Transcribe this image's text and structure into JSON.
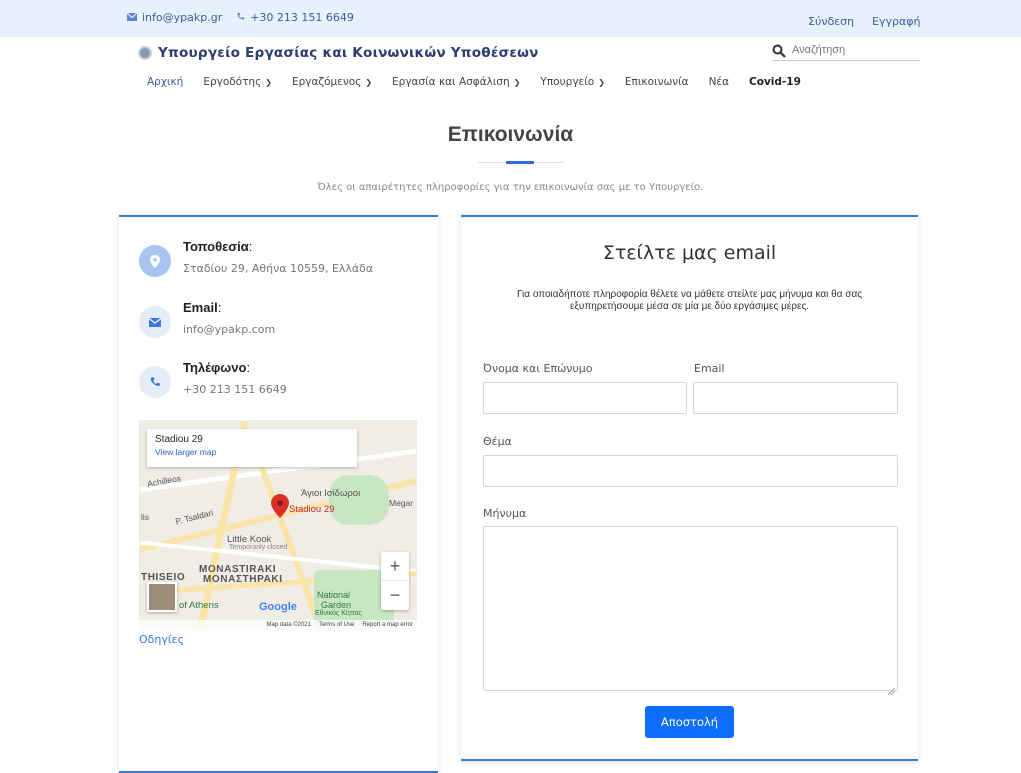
{
  "topbar": {
    "email": "info@ypakp.gr",
    "phone": "+30 213 151 6649",
    "login": "Σύνδεση",
    "register": "Εγγραφή"
  },
  "brand": {
    "name": "Υπουργείο Εργασίας και Κοινωνικών Υποθέσεων"
  },
  "search": {
    "placeholder": "Αναζήτηση"
  },
  "nav": {
    "items": [
      {
        "label": "Αρχική",
        "dropdown": false
      },
      {
        "label": "Εργοδότης",
        "dropdown": true
      },
      {
        "label": "Εργαζόμενος",
        "dropdown": true
      },
      {
        "label": "Εργασία και Ασφάλιση",
        "dropdown": true
      },
      {
        "label": "Υπουργείο",
        "dropdown": true
      },
      {
        "label": "Επικοινωνία",
        "dropdown": false
      },
      {
        "label": "Νέα",
        "dropdown": false
      },
      {
        "label": "Covid-19",
        "dropdown": false
      }
    ]
  },
  "hero": {
    "title": "Επικοινωνία",
    "subtitle": "Όλες οι απαιρέτητες πληροφορίες για την επικοινωνία σας με το Υπουργείο."
  },
  "info": {
    "location_label": "Τοποθεσία",
    "location_value": "Σταδίου 29, Αθήνα 10559, Ελλάδα",
    "email_label": "Email",
    "email_value": "info@ypakp.com",
    "phone_label": "Τηλέφωνο",
    "phone_value": "+30 213 151 6649",
    "colon": ":"
  },
  "map": {
    "place_title": "Stadiou 29",
    "larger_map": "View larger map",
    "labels": {
      "achilleos": "Achilleos",
      "tsaldari": "P. Tsaldari",
      "agioi": "Άγιοι Ισίδωροι",
      "megaro": "Megar",
      "stadiou": "Stadiou 29",
      "little_kook": "Little Kook",
      "temp_closed": "Temporarily closed",
      "monastiraki": "MONASTIRAKI",
      "monastiraki_gr": "ΜΟΝΑΣΤΗΡΑΚΙ",
      "thiseio": "THISEIO",
      "of_athens": "of Athens",
      "national_garden": "National",
      "garden": "Garden",
      "ethnikos": "Εθνικός Κήπος",
      "lis": "lis"
    },
    "zoom_in": "+",
    "zoom_out": "−",
    "google": "Google",
    "footer_data": "Map data ©2021",
    "footer_terms": "Terms of Use",
    "footer_report": "Report a map error",
    "colors": {
      "road": "#fbe4a8",
      "park": "#c9e6c3",
      "pin": "#d93025"
    }
  },
  "directions": "Οδηγίες",
  "form": {
    "title": "Στείλτε μας email",
    "description": "Για οποιαδήποτε πληροφορία θέλετε να μάθετε στείλτε μας μήνυμα και θα σας εξυπηρετήσουμε μέσα σε μία με δύο εργάσιμες μέρες.",
    "name_label": "Όνομα και Επώνυμο",
    "email_label": "Email",
    "subject_label": "Θέμα",
    "message_label": "Μήνυμα",
    "name_value": "",
    "email_value": "",
    "subject_value": "",
    "message_value": "",
    "submit": "Αποστολή"
  },
  "colors": {
    "accent": "#0d6efd",
    "topbar_bg": "#e7f1fb",
    "card_border": "#3a78d9",
    "link": "#3a5d9c"
  }
}
